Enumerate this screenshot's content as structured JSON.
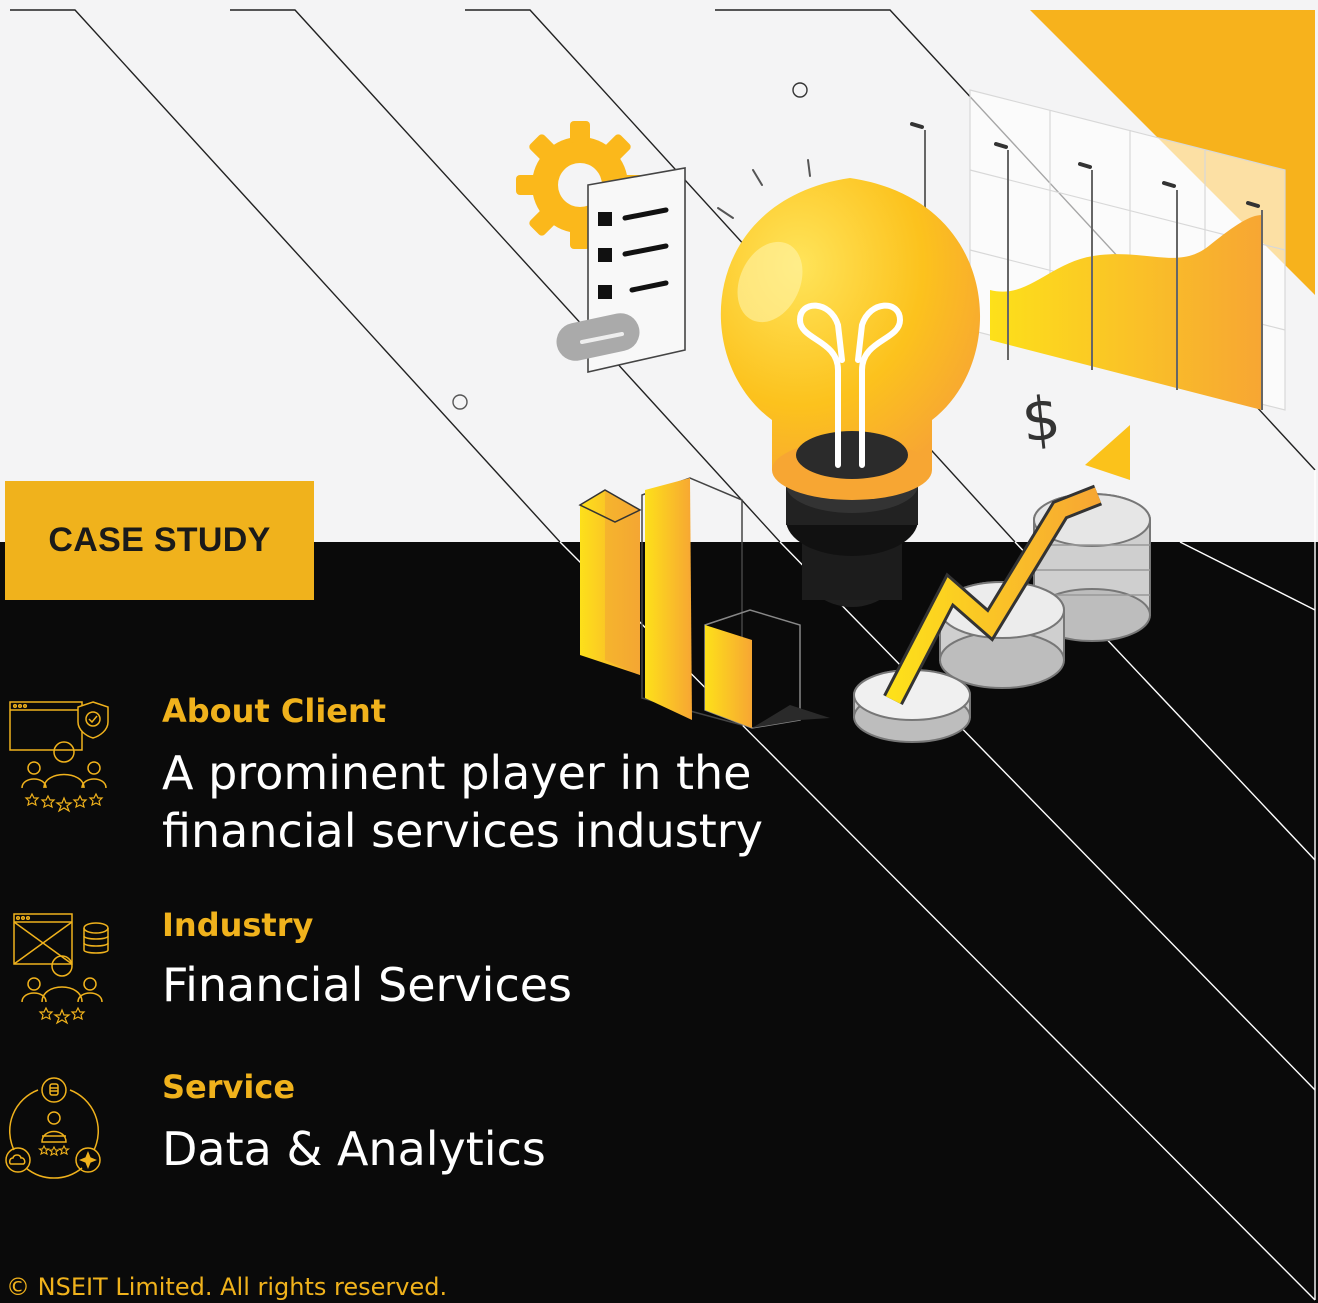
{
  "badge": {
    "label": "CASE STUDY"
  },
  "sections": [
    {
      "label": "About Client",
      "value_line1": "A prominent player in the",
      "value_line2": "financial services industry"
    },
    {
      "label": "Industry",
      "value": "Financial Services"
    },
    {
      "label": "Service",
      "value": "Data & Analytics"
    }
  ],
  "hero": {
    "currency_symbol": "$"
  },
  "footer": {
    "copyright": "© NSEIT Limited. All rights reserved."
  },
  "colors": {
    "accent": "#f0b21c",
    "background_dark": "#0a0a0a",
    "background_light": "#f4f4f5"
  },
  "icons": [
    "client-rating-icon",
    "industry-dashboard-icon",
    "service-network-icon"
  ]
}
